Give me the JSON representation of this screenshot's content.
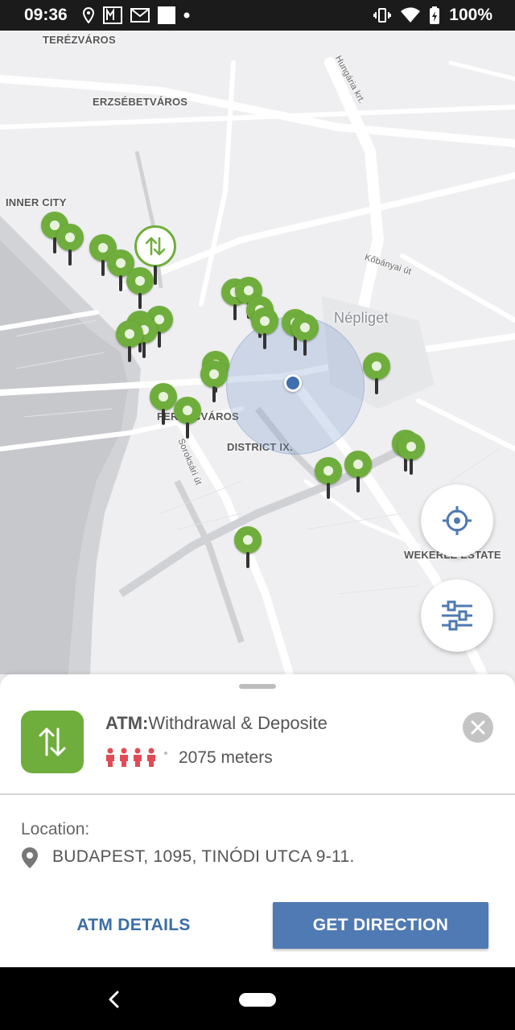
{
  "status_bar": {
    "time": "09:36",
    "battery": "100%",
    "left_icons": [
      "location-icon",
      "news-icon",
      "gmail-icon",
      "square-icon",
      "dot-icon"
    ],
    "right_icons": [
      "vibrate-icon",
      "wifi-icon",
      "battery-icon"
    ]
  },
  "map": {
    "labels": {
      "terezvaros": "TERÉZVÁROS",
      "erzsebetvaros": "ERZSÉBETVÁROS",
      "inner_city": "INNER CITY",
      "nepliget": "Népliget",
      "ferencvaros": "FERENCVÁROS",
      "district_ix": "DISTRICT IX.",
      "wekerle": "WEKERLE ESTATE",
      "hungaria": "Hungária krt.",
      "kobanyai": "Kőbányai út",
      "soroksari": "Soroksári út"
    },
    "pin_count": 27
  },
  "fabs": {
    "locate_icon": "my-location-icon",
    "filter_icon": "filter-sliders-icon"
  },
  "sheet": {
    "atm_label": "ATM:",
    "atm_type": "Withdrawal & Deposite",
    "distance": "2075 meters",
    "crowd_level": 4,
    "location_label": "Location:",
    "address": "BUDAPEST, 1095, TINÓDI UTCA 9-11.",
    "details_button": "ATM DETAILS",
    "direction_button": "GET DIRECTION"
  },
  "colors": {
    "pin_green": "#6fae3c",
    "accent_blue": "#4f7ab3",
    "crowd_red": "#e04b55"
  }
}
